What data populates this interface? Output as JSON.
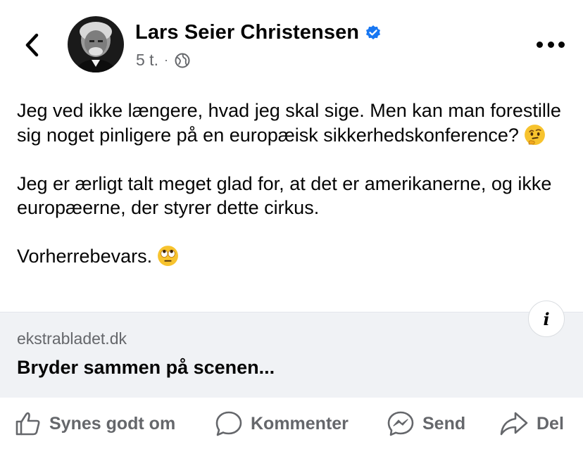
{
  "post": {
    "author": "Lars Seier Christensen",
    "time": "5 t.",
    "separator": "·",
    "paragraphs": [
      "Jeg ved ikke længere, hvad jeg skal sige. Men kan man forestille sig noget pinligere på en europæisk sikkerhedskonference?",
      "Jeg er ærligt talt meget glad for, at det er amerikanerne, og ikke europæerne, der styrer dette cirkus.",
      "Vorherrebevars."
    ],
    "emojis": [
      "thinking-face",
      "rolling-eyes-face"
    ]
  },
  "link": {
    "domain": "ekstrabladet.dk",
    "title": "Bryder sammen på scenen...",
    "info_label": "i"
  },
  "actions": {
    "like": "Synes godt om",
    "comment": "Kommenter",
    "send": "Send",
    "share": "Del"
  },
  "icons": {
    "back": "chevron-left-icon",
    "verified": "verified-badge-icon",
    "privacy": "globe-icon",
    "more": "more-dots-icon",
    "like": "thumbs-up-icon",
    "comment": "speech-bubble-icon",
    "send": "messenger-icon",
    "share": "share-arrow-icon"
  },
  "colors": {
    "verified": "#1877f2",
    "secondary_text": "#65676b",
    "link_card_bg": "#f0f2f5"
  }
}
